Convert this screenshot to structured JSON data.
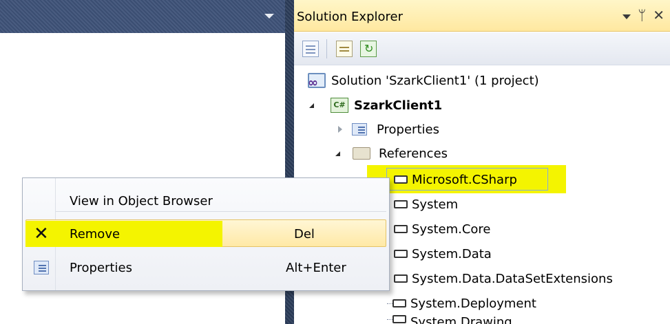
{
  "solution_explorer": {
    "title": "Solution Explorer",
    "title_controls": {
      "pin_glyph": "ᛘ",
      "close_glyph": "✕"
    },
    "toolbar": [
      {
        "icon": "properties-icon"
      },
      {
        "icon": "show-all-files-icon"
      },
      {
        "icon": "refresh-icon"
      }
    ],
    "tree": {
      "solution": "Solution 'SzarkClient1' (1 project)",
      "project": "SzarkClient1",
      "project_icon_text": "C#",
      "properties": "Properties",
      "references": "References",
      "reference_items": [
        "Microsoft.CSharp",
        "System",
        "System.Core",
        "System.Data",
        "System.Data.DataSetExtensions",
        "System.Deployment",
        "System.Drawing"
      ]
    }
  },
  "context_menu": {
    "items": [
      {
        "label": "View in Object Browser",
        "shortcut": ""
      },
      {
        "label": "Remove",
        "shortcut": "Del",
        "icon": "remove-x-icon"
      },
      {
        "label": "Properties",
        "shortcut": "Alt+Enter",
        "icon": "properties-icon"
      }
    ],
    "remove_icon_glyph": "✕"
  },
  "colors": {
    "highlighter": "#f4f400",
    "title_bar": "#ffe8a0",
    "frame": "#3e5278"
  }
}
